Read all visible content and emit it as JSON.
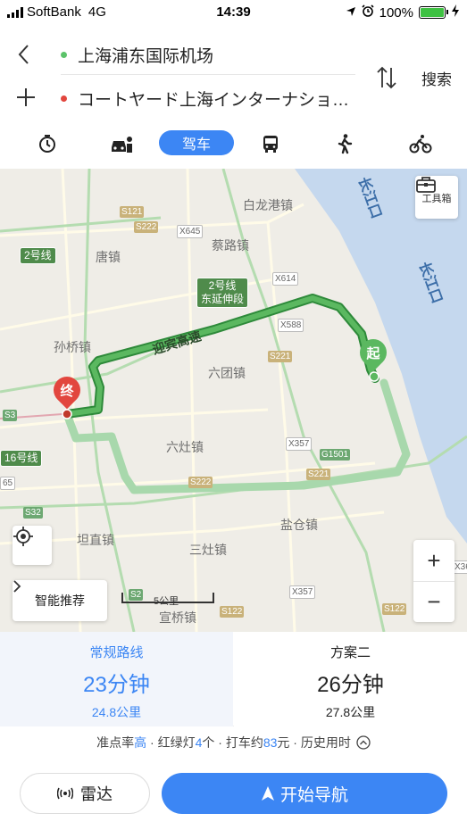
{
  "status_bar": {
    "carrier": "SoftBank",
    "network": "4G",
    "time": "14:39",
    "battery": "100%",
    "battery_level": 1.0
  },
  "route": {
    "start": "上海浦东国际机场",
    "end": "コートヤード上海インターナショ…",
    "search_label": "搜索"
  },
  "modes": {
    "selected_label": "驾车",
    "icons": [
      "stopwatch-icon",
      "taxi-icon",
      "car-label",
      "bus-icon",
      "walk-icon",
      "bike-icon"
    ]
  },
  "map": {
    "places": [
      "白龙港镇",
      "唐镇",
      "蔡路镇",
      "孙桥镇",
      "六团镇",
      "六灶镇",
      "盐仓镇",
      "坦直镇",
      "三灶镇",
      "宣桥镇"
    ],
    "river_labels": [
      "长江口",
      "长江口"
    ],
    "metro_lines": [
      "2号线",
      "2号线\n东延伸段",
      "16号线"
    ],
    "metro_line_2_ext": [
      "2号线",
      "东延伸段"
    ],
    "road_signs": [
      "S121",
      "S222",
      "X645",
      "X614",
      "X588",
      "S221",
      "X357",
      "G1501",
      "S221",
      "S222",
      "S32",
      "S3",
      "S2",
      "X357",
      "S122",
      "S122",
      "X36",
      "65"
    ],
    "highway_label": "迎宾高速",
    "start_marker": "起",
    "end_marker": "终",
    "toolbox_label": "工具箱",
    "smart_label": "智能推荐",
    "scale_label": "5公里",
    "zoom_in": "+",
    "zoom_out": "−"
  },
  "plans": [
    {
      "name": "常规路线",
      "duration": "23分钟",
      "distance": "24.8公里",
      "selected": true
    },
    {
      "name": "方案二",
      "duration": "26分钟",
      "distance": "27.8公里",
      "selected": false
    }
  ],
  "summary": {
    "accuracy_label": "准点率",
    "accuracy_value": "高",
    "lights_label": "· 红绿灯",
    "lights_value": "4",
    "lights_unit": "个 · 打车约",
    "taxi_value": "83",
    "taxi_unit": "元 · 历史用时"
  },
  "actions": {
    "radar_label": "雷达",
    "navigate_label": "开始导航"
  },
  "colors": {
    "accent": "#3c86f4",
    "route_main": "#5bb860",
    "route_alt": "#a8d8ac",
    "water": "#c5d8ee"
  }
}
